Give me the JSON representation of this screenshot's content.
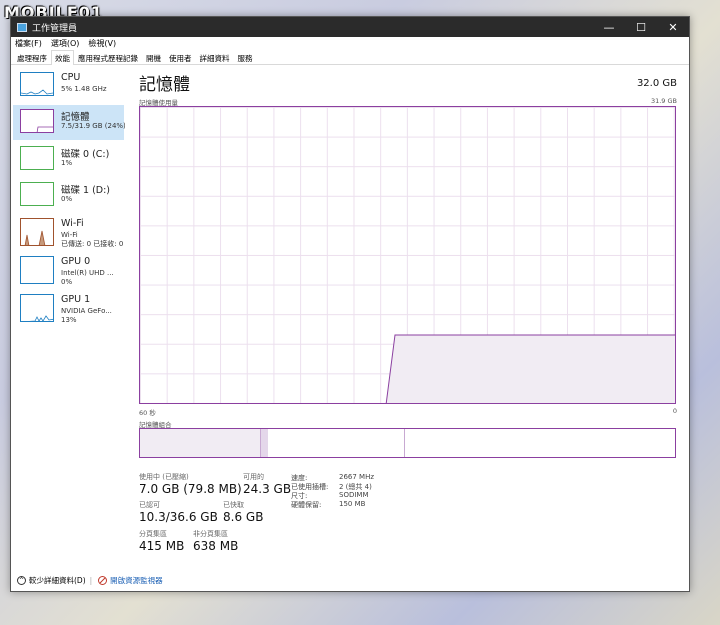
{
  "watermark": "MOBILE01",
  "window": {
    "title": "工作管理員",
    "controls": {
      "minimize": "—",
      "maximize": "☐",
      "close": "✕"
    }
  },
  "menu": [
    "檔案(F)",
    "選項(O)",
    "檢視(V)"
  ],
  "tabs": [
    "處理程序",
    "效能",
    "應用程式歷程記錄",
    "開機",
    "使用者",
    "詳細資料",
    "服務"
  ],
  "active_tab": "效能",
  "sidebar": [
    {
      "name": "CPU",
      "sub": "5% 1.48 GHz",
      "color": "#1f7fc2"
    },
    {
      "name": "記憶體",
      "sub": "7.5/31.9 GB (24%)",
      "color": "#8b3fa0"
    },
    {
      "name": "磁碟 0 (C:)",
      "sub": "1%",
      "color": "#4caf50"
    },
    {
      "name": "磁碟 1 (D:)",
      "sub": "0%",
      "color": "#4caf50"
    },
    {
      "name": "Wi-Fi",
      "sub": "Wi-Fi",
      "sub2": "已傳送: 0 已接收: 0",
      "color": "#a0522d"
    },
    {
      "name": "GPU 0",
      "sub": "Intel(R) UHD ...",
      "sub2": "0%",
      "color": "#1f7fc2"
    },
    {
      "name": "GPU 1",
      "sub": "NVIDIA GeFo...",
      "sub2": "13%",
      "color": "#1f7fc2"
    }
  ],
  "main": {
    "title": "記憶體",
    "capacity": "32.0 GB",
    "graph_label": "記憶體使用量",
    "graph_max": "31.9 GB",
    "time_left": "60 秒",
    "time_right": "0",
    "composition_label": "記憶體組合",
    "usage_fraction_before": 0.0,
    "usage_fraction_now": 0.235,
    "stats": {
      "in_use_label": "使用中 (已壓縮)",
      "in_use_value": "7.0 GB (79.8 MB)",
      "available_label": "可用的",
      "available_value": "24.3 GB",
      "committed_label": "已認可",
      "committed_value": "10.3/36.6 GB",
      "cached_label": "已快取",
      "cached_value": "8.6 GB",
      "paged_label": "分頁集區",
      "paged_value": "415 MB",
      "nonpaged_label": "非分頁集區",
      "nonpaged_value": "638 MB"
    },
    "details": [
      {
        "k": "速度:",
        "v": "2667 MHz"
      },
      {
        "k": "已使用插槽:",
        "v": "2 (總共 4)"
      },
      {
        "k": "尺寸:",
        "v": "SODIMM"
      },
      {
        "k": "硬體保留:",
        "v": "150 MB"
      }
    ]
  },
  "footer": {
    "less_details": "較少詳細資料(D)",
    "open_monitor": "開啟資源監視器"
  }
}
